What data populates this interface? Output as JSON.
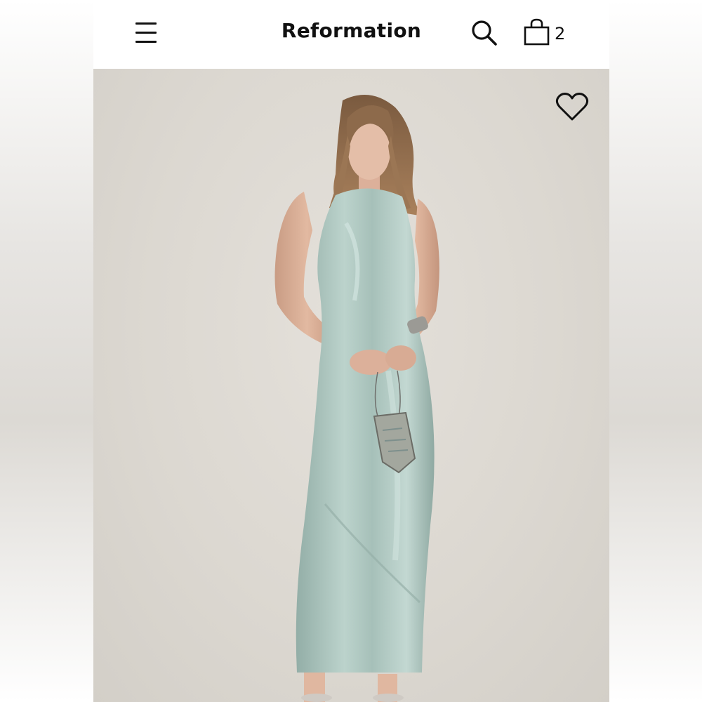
{
  "header": {
    "brand": "Reformation",
    "menu_icon": "hamburger-menu-icon",
    "search_icon": "search-icon",
    "bag_icon": "shopping-bag-icon",
    "bag_count": "2"
  },
  "product": {
    "image_description_icon": "product-photo",
    "dress_color": "#a9c4bc",
    "wishlist_icon": "heart-outline-icon"
  },
  "colors": {
    "header_bg": "#ffffff",
    "text": "#111111",
    "photo_bg": "#dcd8d1"
  }
}
